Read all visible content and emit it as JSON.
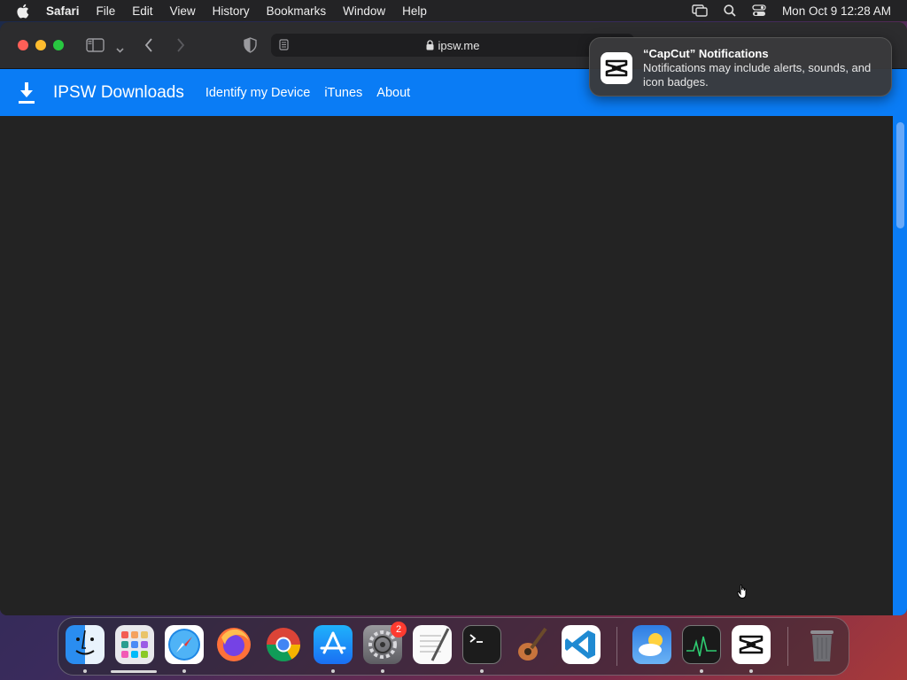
{
  "menubar": {
    "app_name": "Safari",
    "items": [
      "File",
      "Edit",
      "View",
      "History",
      "Bookmarks",
      "Window",
      "Help"
    ],
    "clock": "Mon Oct 9  12:28 AM"
  },
  "browser": {
    "url": "ipsw.me"
  },
  "site": {
    "brand": "IPSW Downloads",
    "nav": [
      "Identify my Device",
      "iTunes",
      "About"
    ],
    "header_color": "#0a7cf5"
  },
  "notification": {
    "title": "“CapCut” Notifications",
    "body": "Notifications may include alerts, sounds, and icon badges."
  },
  "dock": {
    "apps": [
      "finder-icon",
      "launchpad-icon",
      "safari-icon",
      "firefox-icon",
      "chrome-icon",
      "app-store-icon",
      "system-settings-icon",
      "textedit-icon",
      "terminal-icon",
      "garageband-icon",
      "vscode-icon",
      "weather-icon",
      "activity-monitor-icon",
      "capcut-icon",
      "trash-icon"
    ],
    "settings_badge": "2"
  }
}
